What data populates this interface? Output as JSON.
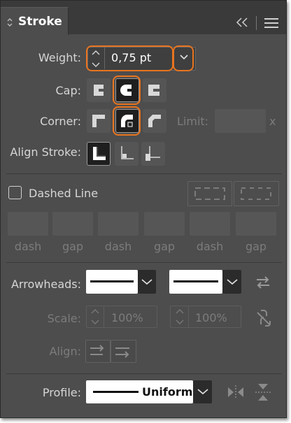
{
  "panel": {
    "title": "Stroke"
  },
  "weight": {
    "label": "Weight:",
    "value": "0,75 pt"
  },
  "cap": {
    "label": "Cap:"
  },
  "corner": {
    "label": "Corner:",
    "limit_label": "Limit:",
    "limit_suffix": "x"
  },
  "align_stroke": {
    "label": "Align Stroke:"
  },
  "dashed": {
    "label": "Dashed Line",
    "checked": false,
    "fields": [
      {
        "label": "dash",
        "value": ""
      },
      {
        "label": "gap",
        "value": ""
      },
      {
        "label": "dash",
        "value": ""
      },
      {
        "label": "gap",
        "value": ""
      },
      {
        "label": "dash",
        "value": ""
      },
      {
        "label": "gap",
        "value": ""
      }
    ]
  },
  "arrowheads": {
    "label": "Arrowheads:"
  },
  "scale": {
    "label": "Scale:",
    "start": "100%",
    "end": "100%"
  },
  "align": {
    "label": "Align:"
  },
  "profile": {
    "label": "Profile:",
    "value": "Uniform"
  },
  "colors": {
    "accent": "#e8741f",
    "panel_bg": "#4d4d4d",
    "header_bg": "#3a3a3a"
  }
}
